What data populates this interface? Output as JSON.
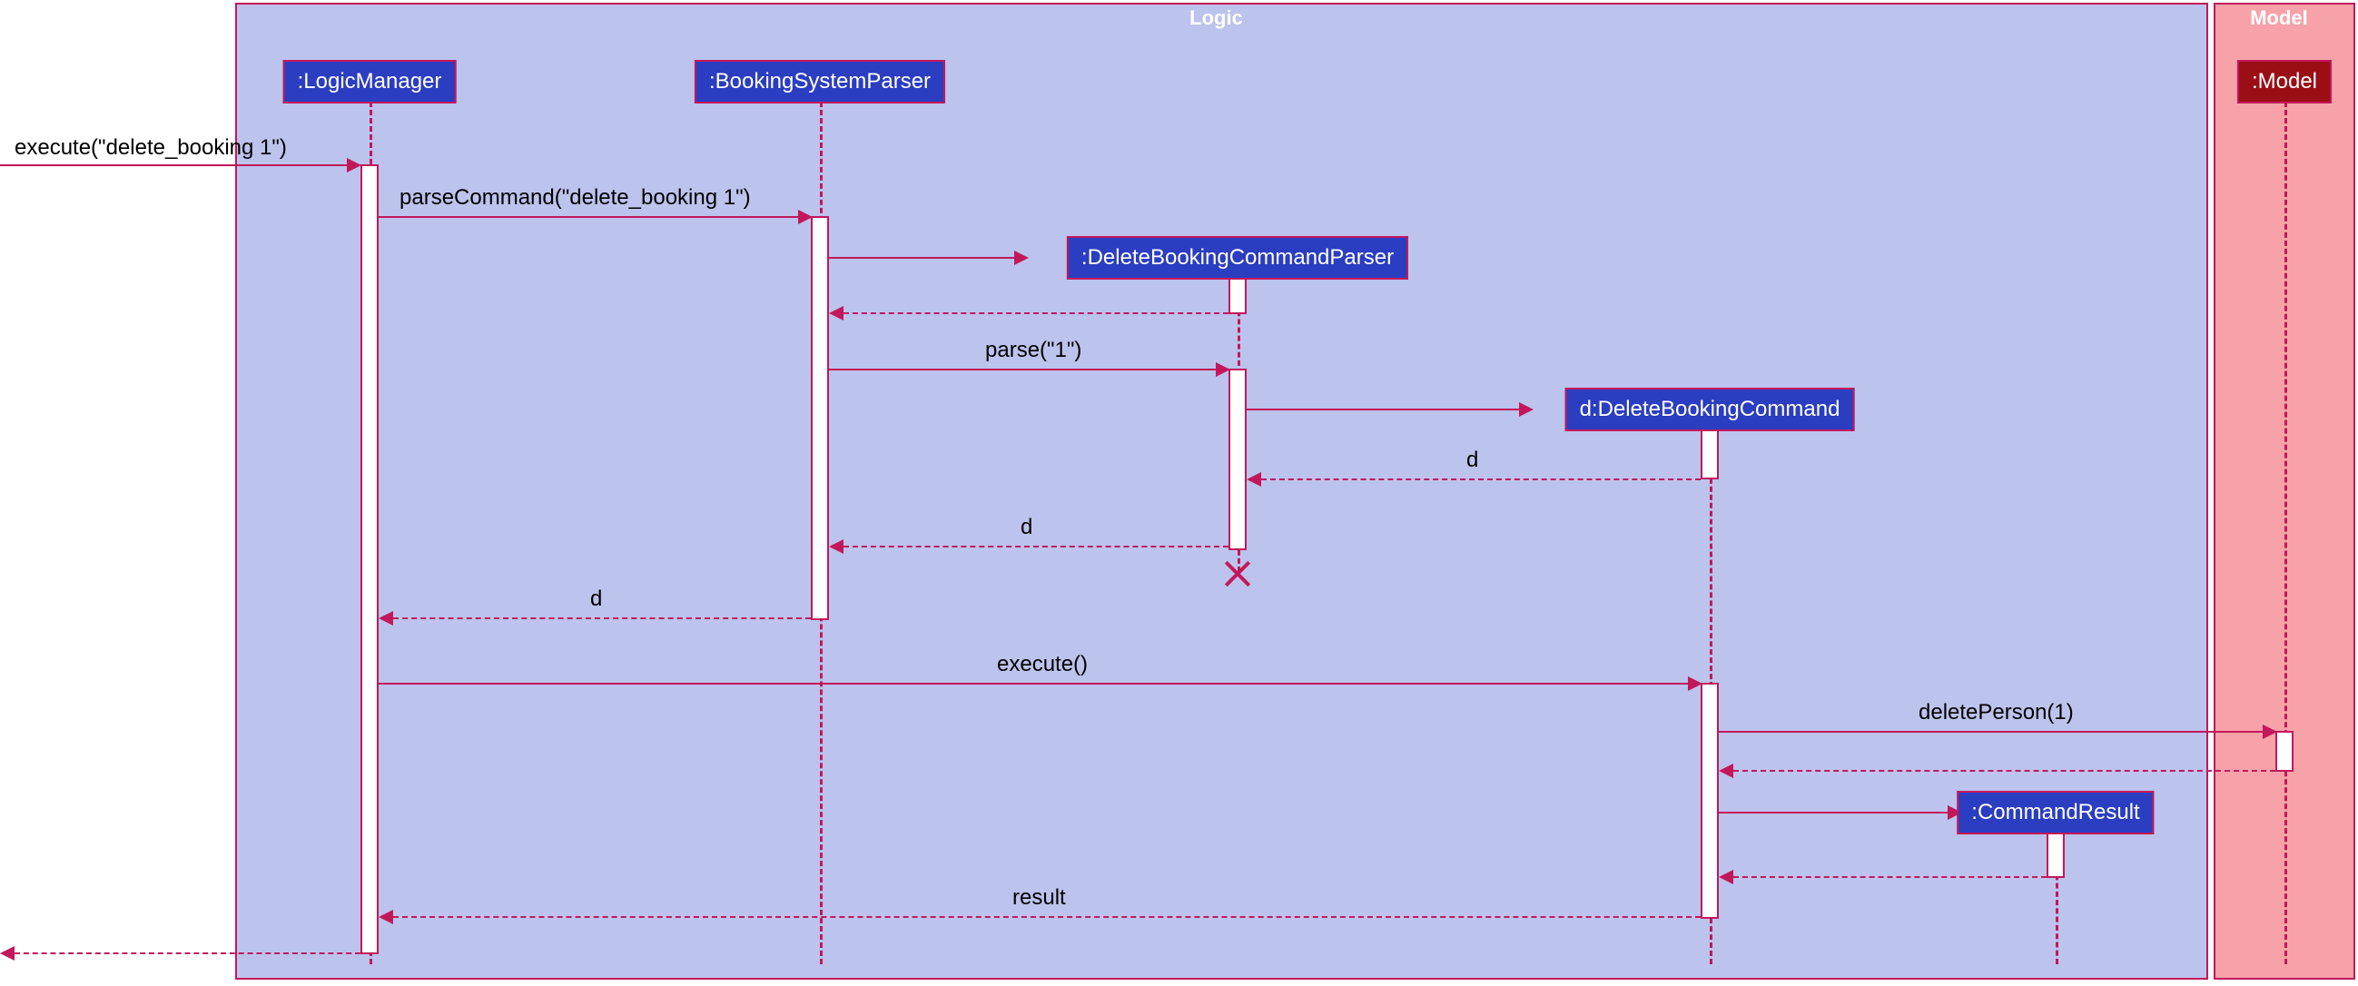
{
  "frames": {
    "logic": {
      "title": "Logic"
    },
    "model": {
      "title": "Model"
    }
  },
  "participants": {
    "logicManager": ":LogicManager",
    "bookingSystemParser": ":BookingSystemParser",
    "deleteBookingCommandParser": ":DeleteBookingCommandParser",
    "deleteBookingCommand": "d:DeleteBookingCommand",
    "commandResult": ":CommandResult",
    "model": ":Model"
  },
  "messages": {
    "execute1": "execute(\"delete_booking 1\")",
    "parseCommand": "parseCommand(\"delete_booking 1\")",
    "parse": "parse(\"1\")",
    "return_d1": "d",
    "return_d2": "d",
    "return_d3": "d",
    "execute2": "execute()",
    "deletePerson": "deletePerson(1)",
    "result": "result"
  }
}
